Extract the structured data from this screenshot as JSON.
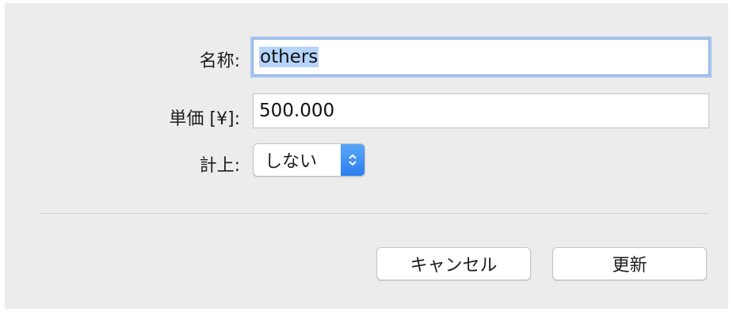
{
  "form": {
    "name": {
      "label": "名称:",
      "value": "others"
    },
    "price": {
      "label": "単価 [¥]:",
      "value": "500.000"
    },
    "accrue": {
      "label": "計上:",
      "selected": "しない",
      "stepper_icon": "up-down-chevrons"
    }
  },
  "buttons": {
    "cancel": "キャンセル",
    "update": "更新"
  },
  "colors": {
    "focus_ring": "#a9c7ee",
    "selection": "#b5d4fb",
    "stepper_blue": "#2a7ff0"
  }
}
